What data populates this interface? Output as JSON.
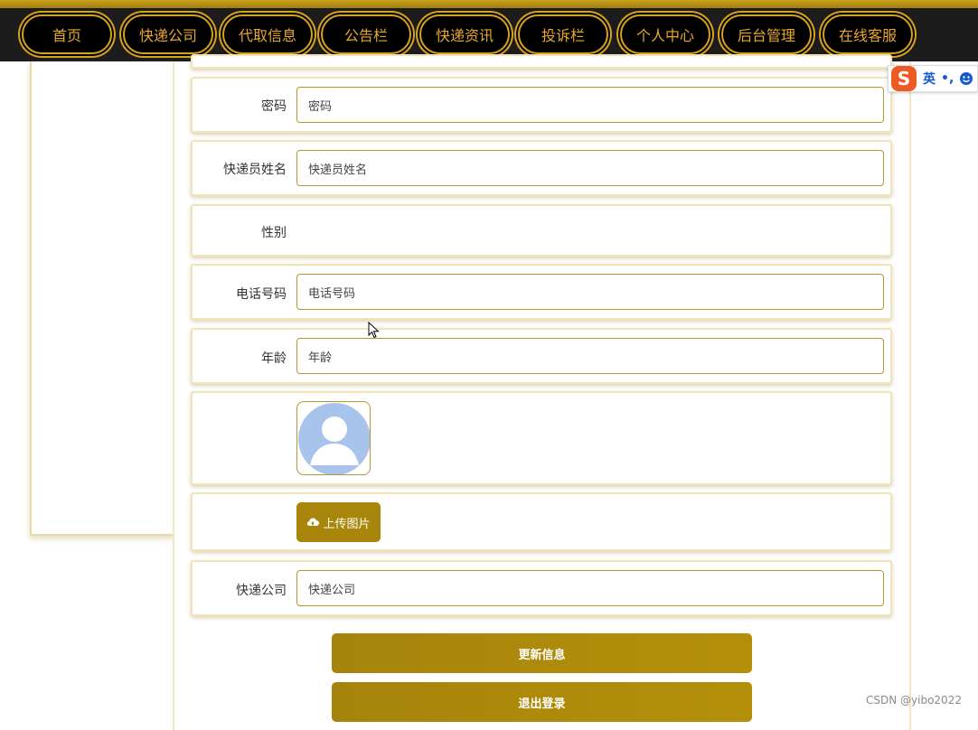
{
  "nav": {
    "items": [
      {
        "label": "首页"
      },
      {
        "label": "快递公司"
      },
      {
        "label": "代取信息"
      },
      {
        "label": "公告栏"
      },
      {
        "label": "快递资讯"
      },
      {
        "label": "投诉栏"
      },
      {
        "label": "个人中心"
      },
      {
        "label": "后台管理"
      },
      {
        "label": "在线客服"
      }
    ]
  },
  "form": {
    "password": {
      "label": "密码",
      "placeholder": "密码"
    },
    "courier_name": {
      "label": "快递员姓名",
      "placeholder": "快递员姓名"
    },
    "gender": {
      "label": "性别"
    },
    "phone": {
      "label": "电话号码",
      "placeholder": "电话号码"
    },
    "age": {
      "label": "年龄",
      "placeholder": "年龄"
    },
    "upload_label": "上传图片",
    "company": {
      "label": "快递公司",
      "placeholder": "快递公司"
    },
    "update_button": "更新信息",
    "logout_button": "退出登录"
  },
  "ime": {
    "lang": "英",
    "punct": "•,"
  },
  "watermark": "CSDN @yibo2022",
  "colors": {
    "accent": "#a8860b",
    "nav_bg": "#1c1c1c",
    "nav_text": "#e8a630",
    "avatar_blue": "#a9c4ec"
  },
  "icons": {
    "upload": "cloud-upload-icon",
    "avatar": "user-avatar-icon",
    "ime_logo": "sogou-s-icon"
  }
}
